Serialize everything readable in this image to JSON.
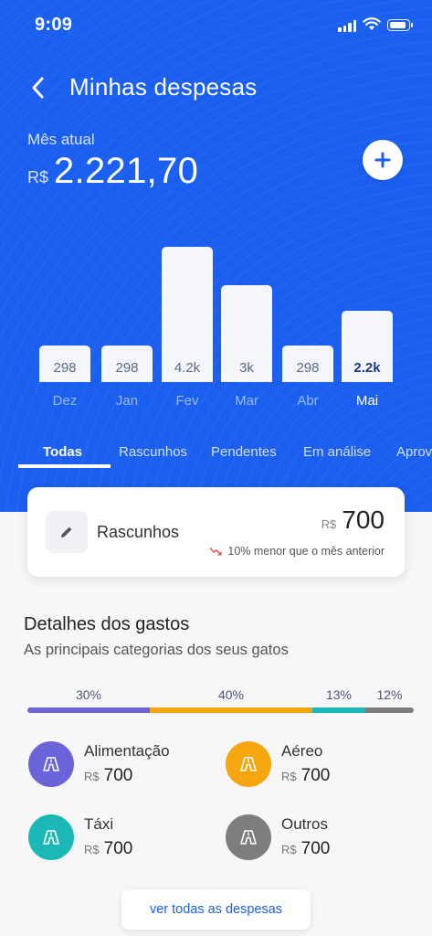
{
  "status_bar": {
    "time": "9:09"
  },
  "header": {
    "title": "Minhas despesas"
  },
  "summary": {
    "label": "Mês atual",
    "currency": "R$",
    "value": "2.221,70"
  },
  "chart_data": {
    "type": "bar",
    "categories": [
      "Dez",
      "Jan",
      "Fev",
      "Mar",
      "Abr",
      "Mai"
    ],
    "values": [
      298,
      298,
      4200,
      3000,
      298,
      2221.7
    ],
    "value_labels": [
      "298",
      "298",
      "4.2k",
      "3k",
      "298",
      "2.2k"
    ],
    "selected": "Mai"
  },
  "tabs": [
    "Todas",
    "Rascunhos",
    "Pendentes",
    "Em análise",
    "Aprov"
  ],
  "draft_card": {
    "label": "Rascunhos",
    "currency": "R$",
    "value": "700",
    "comparison": "10% menor que o mês anterior"
  },
  "details": {
    "title": "Detalhes dos gastos",
    "subtitle": "As principais categorias dos seus gatos",
    "distribution": [
      {
        "label": "30%",
        "fraction": 0.3,
        "color": "#6b63d9"
      },
      {
        "label": "40%",
        "fraction": 0.4,
        "color": "#f5a60f"
      },
      {
        "label": "13%",
        "fraction": 0.13,
        "color": "#1cb8b8"
      },
      {
        "label": "12%",
        "fraction": 0.12,
        "color": "#7d7d7d"
      }
    ],
    "categories": [
      {
        "name": "Alimentação",
        "currency": "R$",
        "value": "700",
        "color": "#6b63d9"
      },
      {
        "name": "Aéreo",
        "currency": "R$",
        "value": "700",
        "color": "#f5a60f"
      },
      {
        "name": "Táxi",
        "currency": "R$",
        "value": "700",
        "color": "#1cb8b8"
      },
      {
        "name": "Outros",
        "currency": "R$",
        "value": "700",
        "color": "#7d7d7d"
      }
    ]
  },
  "footer": {
    "more_label": "ver todas as despesas"
  }
}
